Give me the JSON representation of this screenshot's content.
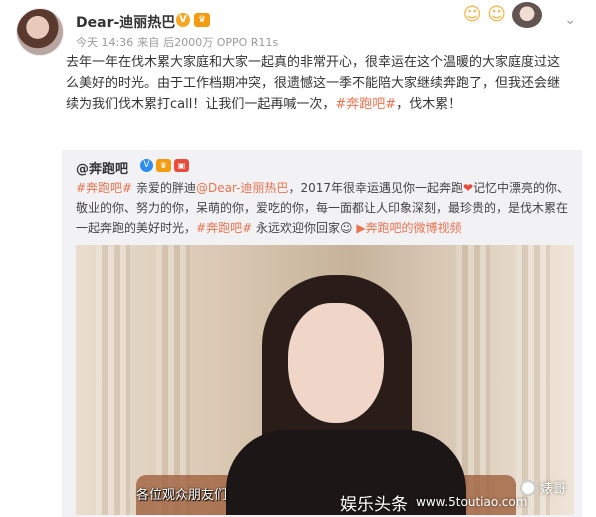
{
  "post": {
    "username": "Dear-迪丽热巴",
    "meta": {
      "time": "今天 14:36",
      "source_prefix": "来自",
      "device": "后2000万 OPPO R11s"
    },
    "text_before": "去年一年在伐木累大家庭和大家一起真的非常开心，很幸运在这个温暖的大家庭度过这么美好的时光。由于工作档期冲突，很遗憾这一季不能陪大家继续奔跑了，但我还会继续为我们伐木累打call！让我们一起再喊一次，",
    "hashtag": "#奔跑吧#",
    "text_after": "，伐木累！"
  },
  "repost": {
    "username": "@奔跑吧",
    "hashtag1": "#奔跑吧#",
    "text1": " 亲爱的胖迪",
    "mention": "@Dear-迪丽热巴",
    "text2": "，2017年很幸运遇见你一起奔跑",
    "text3": "记忆中漂亮的你、敬业的你、努力的你，呆萌的你，爱吃的你，每一面都让人印象深刻，最珍贵的，是伐木累在一起奔跑的美好时光，",
    "hashtag2": "#奔跑吧#",
    "text4": " 永远欢迎你回家",
    "video_link": "奔跑吧的微博视频"
  },
  "video": {
    "subtitle": "各位观众朋友们"
  },
  "watermark": {
    "main": "娱乐头条",
    "site": "www.5toutiao.com",
    "account": "婊哥"
  },
  "icons": [
    "avatar",
    "verified-icon",
    "member-badge-icon",
    "chevron-down-icon",
    "heart-icon",
    "smile-emoji-icon",
    "video-icon"
  ],
  "colors": {
    "accent": "#eb7350",
    "meta": "#999999",
    "repost_bg": "#f2f2f5"
  }
}
